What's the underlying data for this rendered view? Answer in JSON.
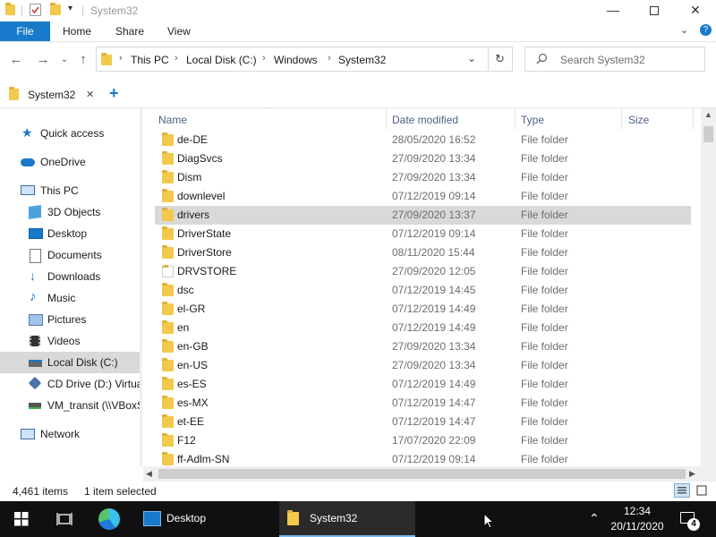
{
  "window": {
    "title": "System32"
  },
  "ribbon": {
    "tabs": [
      "File",
      "Home",
      "Share",
      "View"
    ]
  },
  "address": {
    "crumbs": [
      "This PC",
      "Local Disk (C:)",
      "Windows",
      "System32"
    ]
  },
  "search": {
    "placeholder": "Search System32"
  },
  "tab": {
    "label": "System32",
    "close": "✕",
    "add": "+"
  },
  "nav": {
    "items": [
      {
        "label": "Quick access",
        "icon": "star-icon"
      },
      {
        "label": "OneDrive",
        "icon": "cloud-icon"
      },
      {
        "label": "This PC",
        "icon": "pc-icon"
      },
      {
        "label": "3D Objects",
        "icon": "cube-icon"
      },
      {
        "label": "Desktop",
        "icon": "desktop-icon"
      },
      {
        "label": "Documents",
        "icon": "document-icon"
      },
      {
        "label": "Downloads",
        "icon": "download-icon"
      },
      {
        "label": "Music",
        "icon": "music-icon"
      },
      {
        "label": "Pictures",
        "icon": "picture-icon"
      },
      {
        "label": "Videos",
        "icon": "video-icon"
      },
      {
        "label": "Local Disk (C:)",
        "icon": "drive-icon"
      },
      {
        "label": "CD Drive (D:) Virtua",
        "icon": "cd-drive-icon"
      },
      {
        "label": "VM_transit (\\\\VBoxS",
        "icon": "network-drive-icon"
      },
      {
        "label": "Network",
        "icon": "network-icon"
      }
    ]
  },
  "columns": {
    "name": "Name",
    "date": "Date modified",
    "type": "Type",
    "size": "Size"
  },
  "files": [
    {
      "name": "de-DE",
      "date": "28/05/2020 16:52",
      "type": "File folder"
    },
    {
      "name": "DiagSvcs",
      "date": "27/09/2020 13:34",
      "type": "File folder"
    },
    {
      "name": "Dism",
      "date": "27/09/2020 13:34",
      "type": "File folder"
    },
    {
      "name": "downlevel",
      "date": "07/12/2019 09:14",
      "type": "File folder"
    },
    {
      "name": "drivers",
      "date": "27/09/2020 13:37",
      "type": "File folder"
    },
    {
      "name": "DriverState",
      "date": "07/12/2019 09:14",
      "type": "File folder"
    },
    {
      "name": "DriverStore",
      "date": "08/11/2020 15:44",
      "type": "File folder"
    },
    {
      "name": "DRVSTORE",
      "date": "27/09/2020 12:05",
      "type": "File folder"
    },
    {
      "name": "dsc",
      "date": "07/12/2019 14:45",
      "type": "File folder"
    },
    {
      "name": "el-GR",
      "date": "07/12/2019 14:49",
      "type": "File folder"
    },
    {
      "name": "en",
      "date": "07/12/2019 14:49",
      "type": "File folder"
    },
    {
      "name": "en-GB",
      "date": "27/09/2020 13:34",
      "type": "File folder"
    },
    {
      "name": "en-US",
      "date": "27/09/2020 13:34",
      "type": "File folder"
    },
    {
      "name": "es-ES",
      "date": "07/12/2019 14:49",
      "type": "File folder"
    },
    {
      "name": "es-MX",
      "date": "07/12/2019 14:47",
      "type": "File folder"
    },
    {
      "name": "et-EE",
      "date": "07/12/2019 14:47",
      "type": "File folder"
    },
    {
      "name": "F12",
      "date": "17/07/2020 22:09",
      "type": "File folder"
    },
    {
      "name": "ff-Adlm-SN",
      "date": "07/12/2019 09:14",
      "type": "File folder"
    }
  ],
  "status": {
    "count": "4,461 items",
    "selected": "1 item selected"
  },
  "taskbar": {
    "apps": [
      {
        "label": "Desktop",
        "icon": "desktop-icon"
      },
      {
        "label": "System32",
        "icon": "folder-icon"
      }
    ],
    "time": "12:34",
    "date": "20/11/2020",
    "notification_count": "4"
  },
  "colors": {
    "accent": "#1979ca",
    "selection": "#d9d9d9",
    "folder": "#f2c94c",
    "taskbar": "#101010"
  }
}
